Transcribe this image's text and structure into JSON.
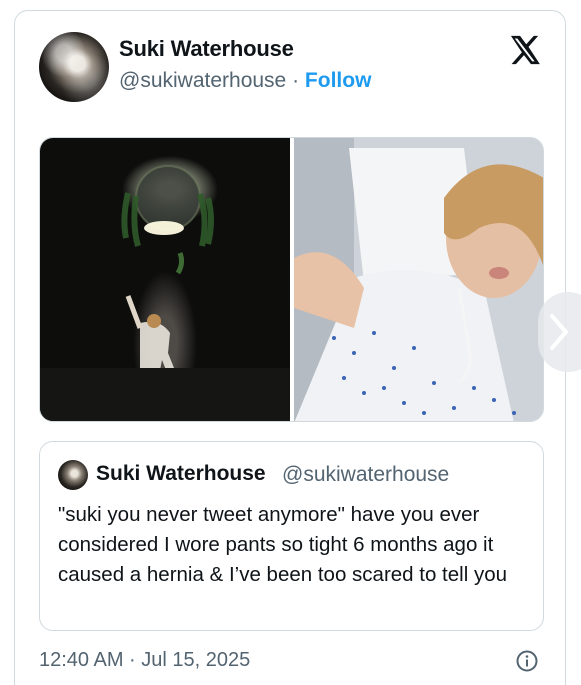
{
  "post": {
    "author_name": "Suki Waterhouse",
    "author_handle": "@sukiwaterhouse",
    "separator": "·",
    "follow_label": "Follow",
    "timestamp": "12:40 AM · Jul 15, 2025"
  },
  "quoted_post": {
    "author_name": "Suki Waterhouse",
    "author_handle": "@sukiwaterhouse",
    "text": "\"suki you never tweet anymore\" have you ever considered I wore pants so tight 6 months ago it caused a hernia & I’ve been too scared to tell you"
  },
  "icons": {
    "brand": "x-logo-icon",
    "info": "info-icon",
    "next": "chevron-right-icon"
  },
  "colors": {
    "accent": "#1d9bf0",
    "text": "#0f1419",
    "secondary": "#536471",
    "border": "#cfd9de"
  }
}
